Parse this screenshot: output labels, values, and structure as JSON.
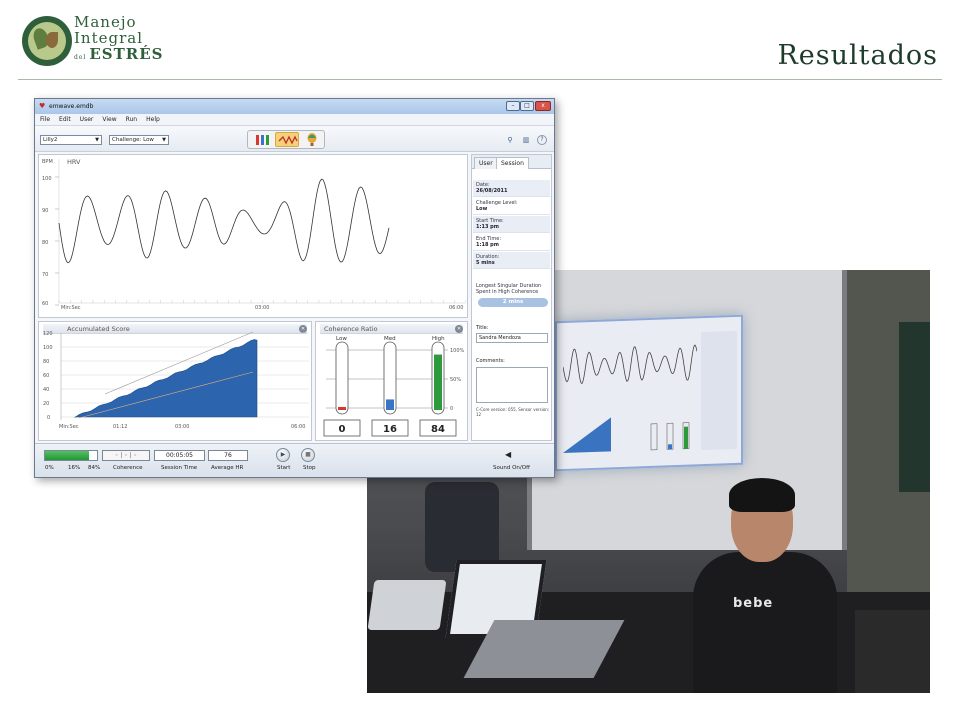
{
  "slide": {
    "title": "Resultados",
    "logo": {
      "line1": "Manejo",
      "line2": "Integral",
      "line3_prefix": "del",
      "line3": "ESTRÉS"
    }
  },
  "app": {
    "window_title": "emwave.emdb",
    "window_buttons": {
      "minimize": "–",
      "maximize": "□",
      "close": "x"
    },
    "menu": [
      "File",
      "Edit",
      "User",
      "View",
      "Run",
      "Help"
    ],
    "toolbar": {
      "user_select": "Lilly2",
      "challenge_select": "Challenge: Low"
    },
    "hrv": {
      "title": "HRV",
      "y_unit": "BPM",
      "y_ticks": [
        "100",
        "90",
        "80",
        "70",
        "60"
      ],
      "x_ticks": [
        "Min:Sec",
        "03:00",
        "06:00"
      ]
    },
    "score": {
      "title": "Accumulated Score",
      "y_ticks": [
        "120",
        "100",
        "80",
        "60",
        "40",
        "20",
        "0"
      ],
      "x_ticks": [
        "Min:Sec",
        "01:12",
        "03:00",
        "06:00"
      ]
    },
    "coherence": {
      "title": "Coherence Ratio",
      "columns": [
        {
          "label": "Low",
          "value": "0",
          "fill": 0.0,
          "color": "#d9382e"
        },
        {
          "label": "Med",
          "value": "16",
          "fill": 0.16,
          "color": "#3a74c8"
        },
        {
          "label": "High",
          "value": "84",
          "fill": 0.84,
          "color": "#2d9a3c"
        }
      ],
      "scale": [
        "100%",
        "50%",
        "0"
      ]
    },
    "session": {
      "tabs": [
        "User",
        "Session"
      ],
      "fields": [
        {
          "key": "Date:",
          "value": "26/08/2011"
        },
        {
          "key": "Challenge Level:",
          "value": "Low"
        },
        {
          "key": "Start Time:",
          "value": "1:13 pm"
        },
        {
          "key": "End Time:",
          "value": "1:18 pm"
        },
        {
          "key": "Duration:",
          "value": "5 mins"
        }
      ],
      "longest_label": "Longest Singular Duration Spent in High Coherence",
      "longest_value": "2 mins",
      "title_label": "Title:",
      "title_value": "Sandra Mendoza",
      "comments_label": "Comments:",
      "version": "C-Core version: 055,  Sensor version: 12"
    },
    "statusbar": {
      "coherence_fill": 0.84,
      "pct_labels": [
        "0%",
        "16%",
        "84%"
      ],
      "coherence_label": "Coherence",
      "coherence_dots": "◦ | ◦ | ◦",
      "session_time": "00:05:05",
      "session_time_label": "Session Time",
      "average_hr": "76",
      "average_hr_label": "Average HR",
      "start_label": "Start",
      "stop_label": "Stop",
      "sound_label": "Sound On/Off"
    }
  },
  "photo": {
    "shirt_text": "bebe"
  }
}
